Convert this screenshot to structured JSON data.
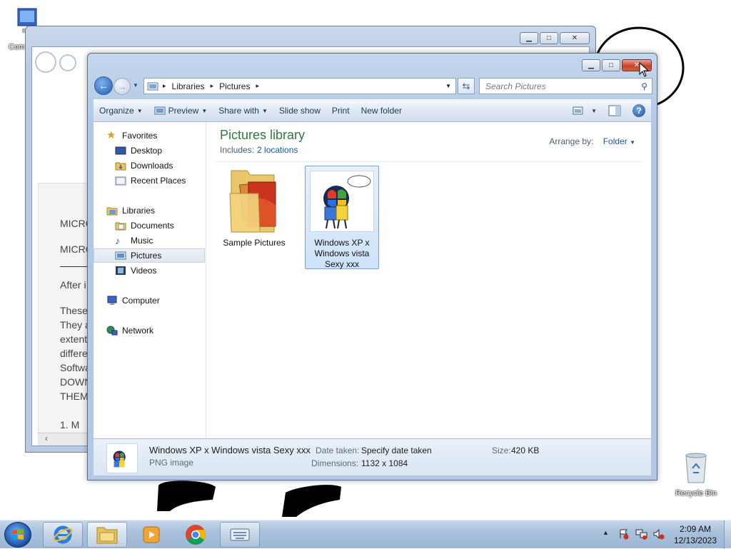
{
  "desktop": {
    "computer_label": "Com",
    "recycle_bin_label": "Recycle Bin"
  },
  "back_window": {
    "doc_lines": [
      "MICRO",
      "MICRO",
      "After i",
      "These",
      "They a",
      "extent",
      "differe",
      "Softwa",
      "DOWN",
      "THEM",
      "1.    M"
    ]
  },
  "explorer": {
    "breadcrumb": [
      "Libraries",
      "Pictures"
    ],
    "search_placeholder": "Search Pictures",
    "toolbar": {
      "organize": "Organize",
      "preview": "Preview",
      "share_with": "Share with",
      "slide_show": "Slide show",
      "print": "Print",
      "new_folder": "New folder"
    },
    "nav": {
      "favorites": "Favorites",
      "desktop": "Desktop",
      "downloads": "Downloads",
      "recent_places": "Recent Places",
      "libraries": "Libraries",
      "documents": "Documents",
      "music": "Music",
      "pictures": "Pictures",
      "videos": "Videos",
      "computer": "Computer",
      "network": "Network"
    },
    "library": {
      "title": "Pictures library",
      "includes_label": "Includes:",
      "includes_link": "2 locations",
      "arrange_label": "Arrange by:",
      "arrange_value": "Folder"
    },
    "items": [
      {
        "name": "Sample Pictures"
      },
      {
        "name": "Windows XP x Windows vista Sexy xxx"
      }
    ],
    "details": {
      "file_name": "Windows XP x Windows vista Sexy xxx",
      "file_type": "PNG image",
      "date_taken_label": "Date taken:",
      "date_taken_value": "Specify date taken",
      "dimensions_label": "Dimensions:",
      "dimensions_value": "1132 x 1084",
      "size_label": "Size:",
      "size_value": "420 KB"
    }
  },
  "taskbar": {
    "time": "2:09 AM",
    "date": "12/13/2023"
  }
}
